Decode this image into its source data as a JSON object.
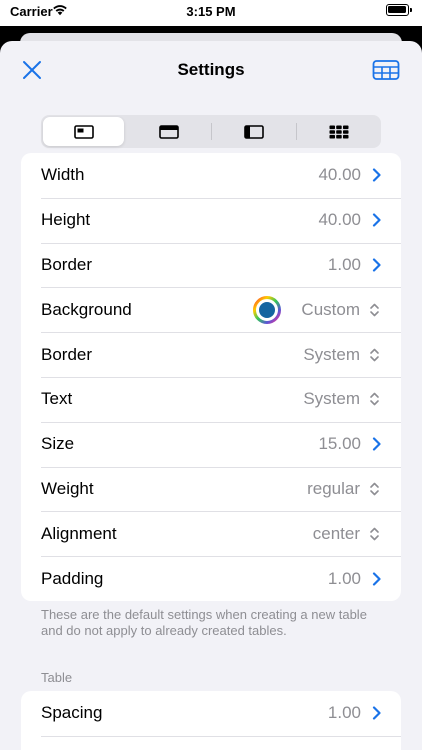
{
  "status_bar": {
    "carrier": "Carrier",
    "time": "3:15 PM"
  },
  "nav": {
    "title": "Settings",
    "close_icon": "close-icon",
    "table_icon": "table-icon"
  },
  "segments": [
    {
      "icon": "cell-layout-icon",
      "selected": true
    },
    {
      "icon": "header-layout-icon",
      "selected": false
    },
    {
      "icon": "sidebar-layout-icon",
      "selected": false
    },
    {
      "icon": "grid-layout-icon",
      "selected": false
    }
  ],
  "cell_settings": {
    "width": {
      "label": "Width",
      "value": "40.00"
    },
    "height": {
      "label": "Height",
      "value": "40.00"
    },
    "border_width": {
      "label": "Border",
      "value": "1.00"
    },
    "background": {
      "label": "Background",
      "value": "Custom"
    },
    "border_color": {
      "label": "Border",
      "value": "System"
    },
    "text": {
      "label": "Text",
      "value": "System"
    },
    "size": {
      "label": "Size",
      "value": "15.00"
    },
    "weight": {
      "label": "Weight",
      "value": "regular"
    },
    "alignment": {
      "label": "Alignment",
      "value": "center"
    },
    "padding": {
      "label": "Padding",
      "value": "1.00"
    }
  },
  "footer_note": "These are the default settings when creating a new table and do not apply to already created tables.",
  "table_section": {
    "header": "Table",
    "spacing": {
      "label": "Spacing",
      "value": "1.00"
    }
  },
  "colors": {
    "accent": "#1a73e8",
    "swatch": "#1565a0"
  }
}
